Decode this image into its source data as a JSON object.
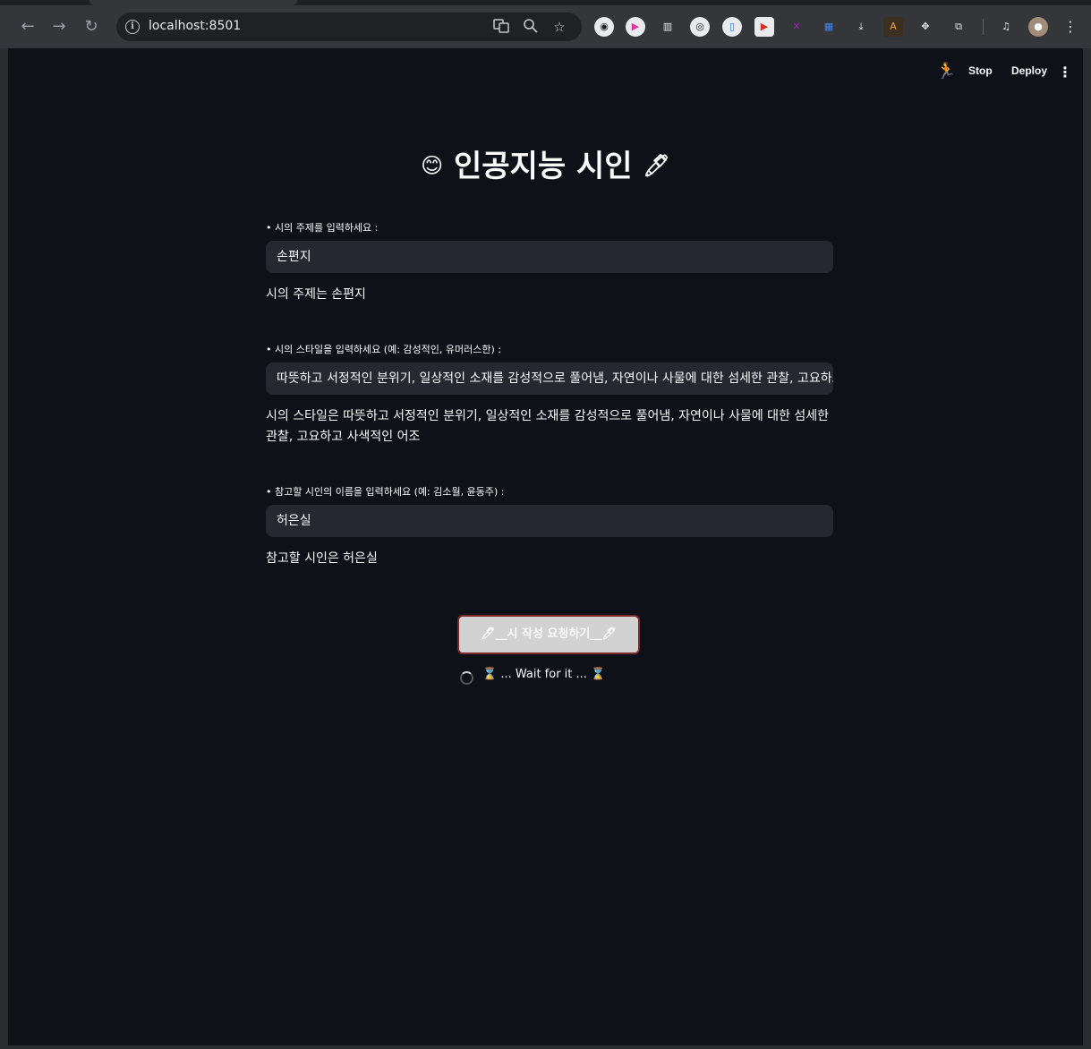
{
  "browser": {
    "url": "localhost:8501",
    "nav": {
      "back": "←",
      "forward": "→",
      "reload": "↻"
    },
    "omnibox_icons": [
      "translate-icon",
      "zoom-icon",
      "star-icon"
    ],
    "extensions": [
      "ext-1",
      "ext-2",
      "ext-3",
      "ext-4",
      "ext-5",
      "ext-6",
      "ext-7",
      "ext-8",
      "ext-9",
      "ext-10",
      "ext-11",
      "puzzle-icon",
      "media-icon",
      "profile-avatar",
      "kebab-menu-icon"
    ]
  },
  "header": {
    "stop_label": "Stop",
    "deploy_label": "Deploy",
    "menu_glyph": "⋮",
    "runner_glyph": "🏃"
  },
  "page": {
    "title_prefix_emoji": "😊",
    "title": "인공지능 시인",
    "title_suffix_emoji": "🖊",
    "topic": {
      "label": "• 시의 주제를 입력하세요 :",
      "value": "손편지",
      "echo": "시의 주제는 손편지"
    },
    "style": {
      "label": "• 시의 스타일을 입력하세요 (예: 감성적인, 유머러스한) :",
      "value": "따뜻하고 서정적인 분위기, 일상적인 소재를 감성적으로 풀어냄, 자연이나 사물에 대한 섬세한 관찰, 고요하고 사색적인 어조",
      "echo": "시의 스타일은 따뜻하고 서정적인 분위기, 일상적인 소재를 감성적으로 풀어냄, 자연이나 사물에 대한 섬세한 관찰, 고요하고 사색적인 어조"
    },
    "poet": {
      "label": "• 참고할 시인의 이름을 입력하세요 (예: 김소월, 윤동주) :",
      "value": "허은실",
      "echo": "참고할 시인은 허은실"
    },
    "submit_label": "🖊__시 작성 요청하기__🖊",
    "status_text": "⌛ ... Wait for it ... ⌛"
  },
  "colors": {
    "app_bg": "#0e1117",
    "input_bg": "#262730",
    "button_bg": "#d2d2d2",
    "button_border": "#7a2a2a",
    "chrome_bg": "#35363a"
  }
}
